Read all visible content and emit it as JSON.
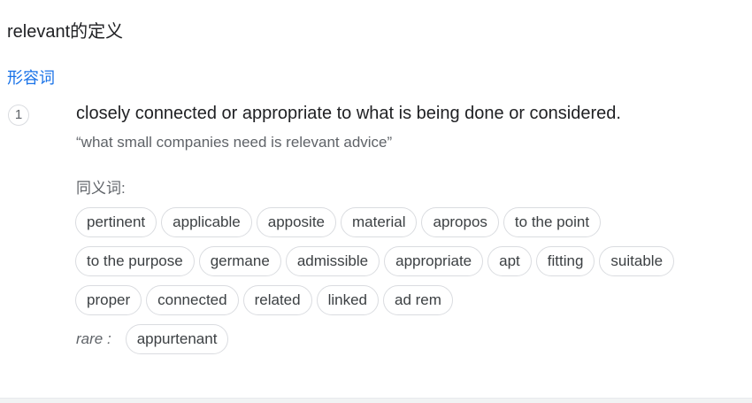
{
  "header": {
    "title": "relevant的定义"
  },
  "entry": {
    "part_of_speech": "形容词",
    "sense_number": "1",
    "definition": "closely connected or appropriate to what is being done or considered.",
    "example": "“what small companies need is relevant advice”",
    "synonyms_label": "同义词:",
    "synonym_rows": [
      [
        "pertinent",
        "applicable",
        "apposite",
        "material",
        "apropos",
        "to the point"
      ],
      [
        "to the purpose",
        "germane",
        "admissible",
        "appropriate",
        "apt",
        "fitting",
        "suitable"
      ],
      [
        "proper",
        "connected",
        "related",
        "linked",
        "ad rem"
      ]
    ],
    "rare_label": "rare :",
    "rare_synonyms": [
      "appurtenant"
    ]
  }
}
